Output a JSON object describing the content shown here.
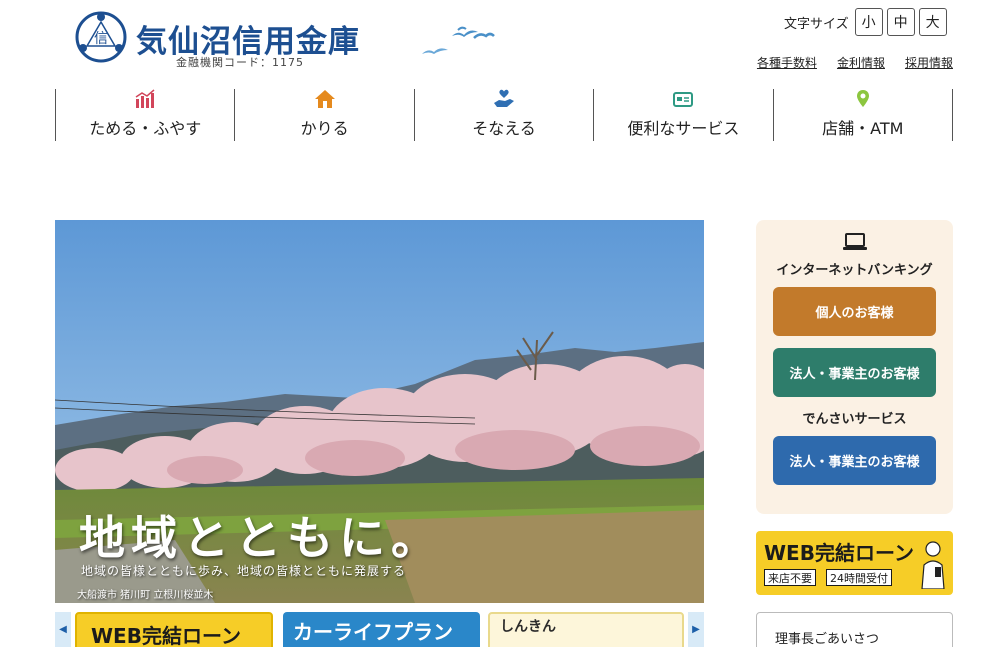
{
  "header": {
    "bank_name": "気仙沼信用金庫",
    "institution_code": "金融機関コード：1175",
    "logo_char": "信",
    "font_size": {
      "label": "文字サイズ",
      "small": "小",
      "medium": "中",
      "large": "大"
    },
    "links": [
      "各種手数料",
      "金利情報",
      "採用情報"
    ]
  },
  "nav": [
    {
      "label": "ためる・ふやす",
      "icon": "chart-bar-icon",
      "color": "#d2455a"
    },
    {
      "label": "かりる",
      "icon": "house-icon",
      "color": "#e58a1e"
    },
    {
      "label": "そなえる",
      "icon": "hand-heart-icon",
      "color": "#2f6fb3"
    },
    {
      "label": "便利なサービス",
      "icon": "card-icon",
      "color": "#2e9a84"
    },
    {
      "label": "店舗・ATM",
      "icon": "map-pin-icon",
      "color": "#8cc63f"
    }
  ],
  "hero": {
    "title": "地域とともに。",
    "subtitle": "地域の皆様とともに歩み、地域の皆様とともに発展する",
    "caption": "大船渡市 猪川町 立根川桜並木"
  },
  "banners": {
    "web_loan": "WEB完結ローン",
    "car_loan": "カーライフプラン",
    "card_loan": "しんきん"
  },
  "internet_banking": {
    "title": "インターネットバンキング",
    "personal": "個人のお客様",
    "corporate": "法人・事業主のお客様",
    "densai_title": "でんさいサービス",
    "densai_corporate": "法人・事業主のお客様"
  },
  "web_banner": {
    "title": "WEB完結ローン",
    "tag1": "来店不要",
    "tag2": "24時間受付"
  },
  "greeting": "理事長ごあいさつ",
  "colors": {
    "brand": "#1d4f91",
    "personal_btn": "#c27a2b",
    "corporate_btn": "#2e7d6b",
    "densai_btn": "#2e6aad",
    "ib_box_bg": "#fbf1e4",
    "web_yellow": "#f6cd27"
  }
}
